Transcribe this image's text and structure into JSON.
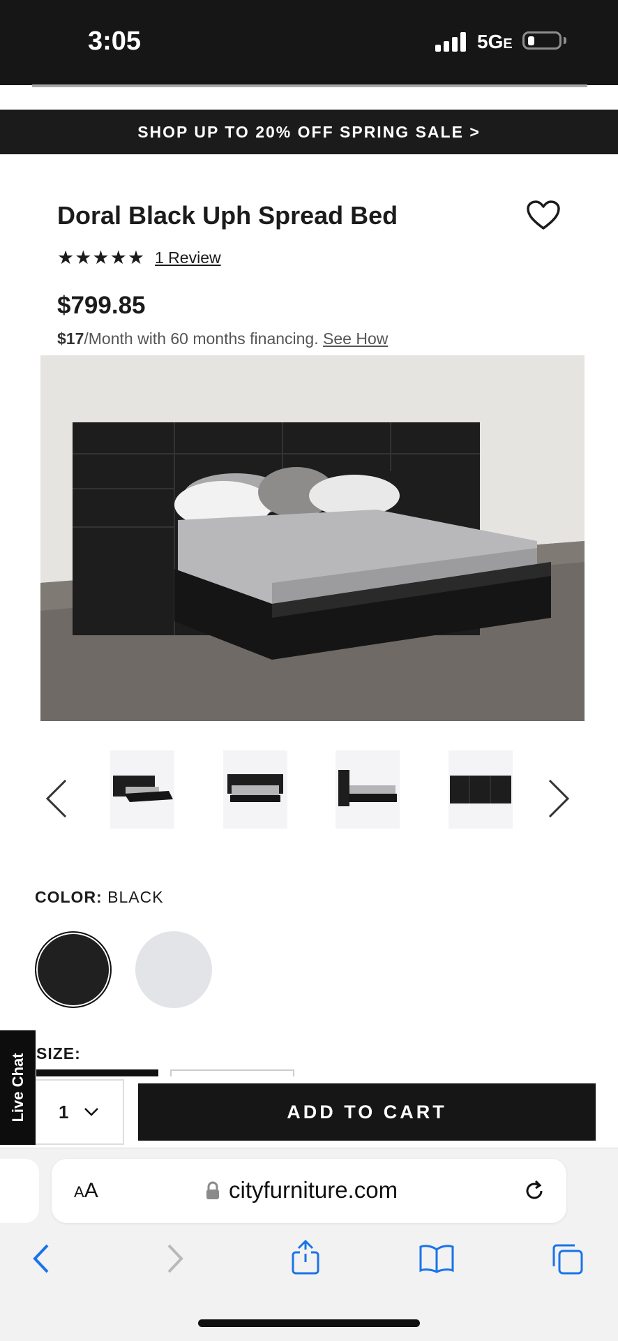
{
  "status_bar": {
    "time": "3:05",
    "network": "5G",
    "network_suffix": "E"
  },
  "promo": {
    "text": "SHOP UP TO 20% OFF SPRING SALE >"
  },
  "product": {
    "title": "Doral Black Uph Spread Bed",
    "rating": 5,
    "rating_stars": "★★★★★",
    "review_link": "1 Review",
    "price": "$799.85",
    "finance_amount": "$17",
    "finance_text": "/Month with 60 months financing.",
    "finance_link": "See How"
  },
  "gallery": {
    "thumbnails": [
      "bed-angle-thumbnail",
      "bed-front-thumbnail",
      "bed-side-thumbnail",
      "headboard-thumbnail"
    ]
  },
  "color": {
    "label": "COLOR:",
    "value": "BLACK",
    "options": [
      "black",
      "white"
    ],
    "selected": "black",
    "swatch_colors": [
      "#202020",
      "#e3e4e8"
    ]
  },
  "size": {
    "label": "SIZE:"
  },
  "live_chat": {
    "label": "Live Chat"
  },
  "cart": {
    "quantity": "1",
    "add_label": "ADD TO CART"
  },
  "browser": {
    "aa_big": "A",
    "aa_small": "A",
    "url": "cityfurniture.com"
  },
  "colors": {
    "dark": "#161616",
    "accent_blue": "#1a73e8"
  }
}
